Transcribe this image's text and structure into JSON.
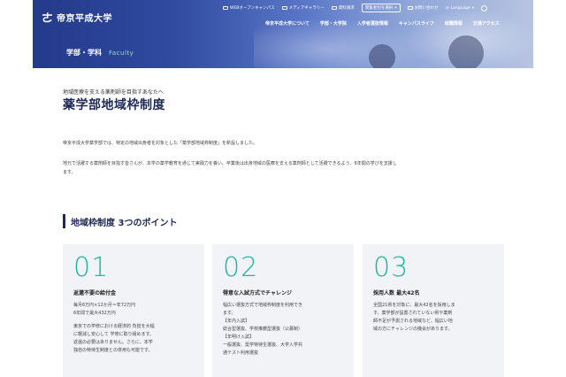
{
  "header": {
    "logo_mark": "ㄜ",
    "logo_text": "帝京平成大学",
    "utility": {
      "web_campus": "WEBオープンキャンパス",
      "media_gallery": "メディアギャラリー",
      "materials": "資料請求",
      "select_label": "閲覧者別を選択",
      "close_label": "お問い合わせ",
      "language": "Language"
    },
    "nav": [
      "帝京平成大学について",
      "学部・大学院",
      "入学者選抜情報",
      "キャンパスライフ",
      "就職情報",
      "交通アクセス"
    ],
    "section_jp": "学部・学科",
    "section_en": "Faculty"
  },
  "page": {
    "subtitle": "地域医療を支える薬剤師を目指すあなたへ",
    "title": "薬学部地域枠制度",
    "para1": "帝京平成大学薬学部では、特定の地域出身者を対象とした「薬学部地域枠制度」を新設しました。",
    "para2_line1": "地元で活躍する薬剤師を目指す皆さんが、本学の薬学教育を通じて実践力を養い、卒業後は出身地域の医療を支える薬剤師として活躍できるよう、6年間の学びを支援し",
    "para2_line2": "ます。"
  },
  "section": {
    "title": "地域枠制度 3つのポイント"
  },
  "cards": [
    {
      "num": "01",
      "head": "返還不要の給付金",
      "lines_a": [
        "毎月6万円×12か月＝年72万円",
        "6年間で最大432万円"
      ],
      "lines_b": [
        "東京での学修における経済的 負担を大幅",
        "に軽減し安心して 学修に取り組めます。",
        "返還の必要はありません。さらに、本学",
        "独自の特待生制度との併用も可能です。"
      ]
    },
    {
      "num": "02",
      "head": "得意な入試方式でチャレンジ",
      "lines_a": [
        "幅広い選抜方式で地域枠制度を利用でき",
        "ます。",
        "【年内入試】",
        "総合型選抜、学校推薦型選抜（公募制）",
        "【年明け入試】",
        "一般選抜、奨学特待生選抜、大学入学共",
        "通テスト利用選抜"
      ],
      "lines_b": []
    },
    {
      "num": "03",
      "head": "採用人数 最大42名",
      "lines_a": [
        "全国21県を対象に、最大42名を採用しま",
        "す。薬学部が設置されていない県や薬剤",
        "師不足が予測される地域など、幅広い地",
        "域の方にチャレンジの機会があります。"
      ],
      "lines_b": []
    }
  ],
  "colors": {
    "accent": "#22b5a4",
    "navy": "#1d2a55",
    "card_bg": "#f1f3f6"
  }
}
